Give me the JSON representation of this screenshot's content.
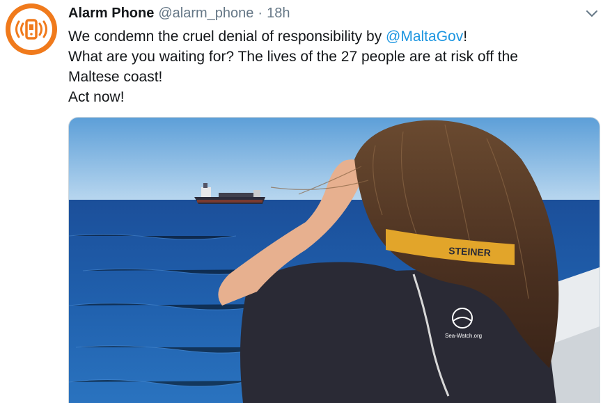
{
  "tweet": {
    "author_name": "Alarm Phone",
    "author_handle": "@alarm_phone",
    "separator": "·",
    "timestamp": "18h",
    "text": {
      "line1_prefix": "We condemn the cruel denial of responsibility by ",
      "line1_mention": "@MaltaGov",
      "line1_suffix": "!",
      "line2": "What are you waiting for? The lives of the 27 people are at risk off the",
      "line3": "Maltese coast!",
      "line4": "Act now!"
    },
    "media": {
      "lifejacket_brand": "STEINER",
      "shirt_logo_text": "Sea-Watch.org"
    }
  },
  "icons": {
    "avatar": "alarm-phone-logo-icon",
    "menu": "chevron-down-icon"
  },
  "colors": {
    "brand_orange": "#f07a1c",
    "link_blue": "#1b95e0",
    "muted_text": "#657786",
    "primary_text": "#14171a"
  }
}
